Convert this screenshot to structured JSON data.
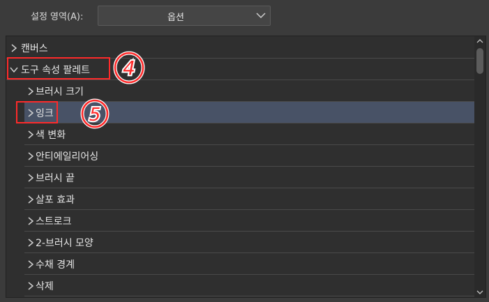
{
  "header": {
    "setting_area_label": "설정 영역(A):",
    "setting_area_value": "옵션",
    "chevron_icon": "chevron-down-icon"
  },
  "tree": {
    "items": [
      {
        "label": "캔버스",
        "expanded": false,
        "level": 0,
        "selected": false
      },
      {
        "label": "도구 속성 팔레트",
        "expanded": true,
        "level": 0,
        "selected": false
      },
      {
        "label": "브러시 크기",
        "expanded": false,
        "level": 1,
        "selected": false
      },
      {
        "label": "잉크",
        "expanded": false,
        "level": 1,
        "selected": true
      },
      {
        "label": "색 변화",
        "expanded": false,
        "level": 1,
        "selected": false
      },
      {
        "label": "안티에일리어싱",
        "expanded": false,
        "level": 1,
        "selected": false
      },
      {
        "label": "브러시 끝",
        "expanded": false,
        "level": 1,
        "selected": false
      },
      {
        "label": "살포 효과",
        "expanded": false,
        "level": 1,
        "selected": false
      },
      {
        "label": "스트로크",
        "expanded": false,
        "level": 1,
        "selected": false
      },
      {
        "label": "2-브러시 모양",
        "expanded": false,
        "level": 1,
        "selected": false
      },
      {
        "label": "수채 경계",
        "expanded": false,
        "level": 1,
        "selected": false
      },
      {
        "label": "삭제",
        "expanded": false,
        "level": 1,
        "selected": false
      }
    ]
  },
  "annotations": {
    "color": "#ff2a2a",
    "marks": [
      {
        "number": "4",
        "target": "도구 속성 팔레트"
      },
      {
        "number": "5",
        "target": "잉크"
      }
    ]
  },
  "colors": {
    "background": "#3b3b3b",
    "panel": "#2f2f2f",
    "selected_row": "#485266",
    "text": "#e6e6e6"
  }
}
